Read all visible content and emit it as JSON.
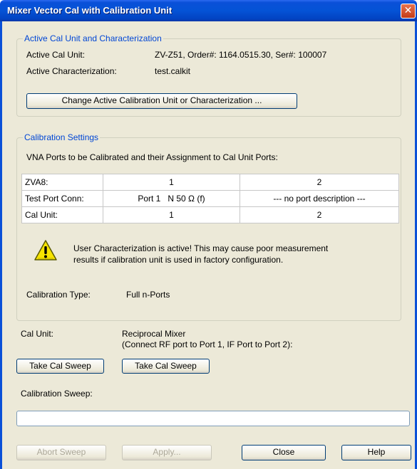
{
  "window": {
    "title": "Mixer Vector Cal with Calibration Unit",
    "close_glyph": "✕"
  },
  "active_cal": {
    "legend": "Active Cal Unit and Characterization",
    "unit_label": "Active Cal Unit:",
    "unit_value": "ZV-Z51, Order#: 1164.0515.30, Ser#: 100007",
    "char_label": "Active Characterization:",
    "char_value": "test.calkit",
    "change_button": "Change Active Calibration Unit or Characterization ..."
  },
  "cal_settings": {
    "legend": "Calibration Settings",
    "ports_heading": "VNA Ports to be Calibrated and their Assignment to Cal Unit Ports:",
    "table": {
      "rows": [
        [
          "ZVA8:",
          "1",
          "2"
        ],
        [
          "Test Port Conn:",
          "Port 1   N 50 Ω (f)",
          "--- no port description ---"
        ],
        [
          "Cal Unit:",
          "1",
          "2"
        ]
      ]
    },
    "warning_icon": "warning-triangle-icon",
    "warning_line1": "User Characterization is active! This may cause poor measurement",
    "warning_line2": "results if calibration unit is used in factory configuration.",
    "type_label": "Calibration Type:",
    "type_value": "Full n-Ports"
  },
  "sweep": {
    "cal_unit_label": "Cal Unit:",
    "mixer_label_line1": "Reciprocal Mixer",
    "mixer_label_line2": "(Connect RF port to Port 1, IF Port to Port 2):",
    "take_sweep_1": "Take Cal Sweep",
    "take_sweep_2": "Take Cal Sweep",
    "progress_label": "Calibration Sweep:"
  },
  "footer": {
    "abort": "Abort Sweep",
    "apply": "Apply...",
    "close": "Close",
    "help": "Help"
  },
  "colors": {
    "title_bar": "#0453d6",
    "legend_text": "#0046d5",
    "dialog_bg": "#ece9d8"
  }
}
